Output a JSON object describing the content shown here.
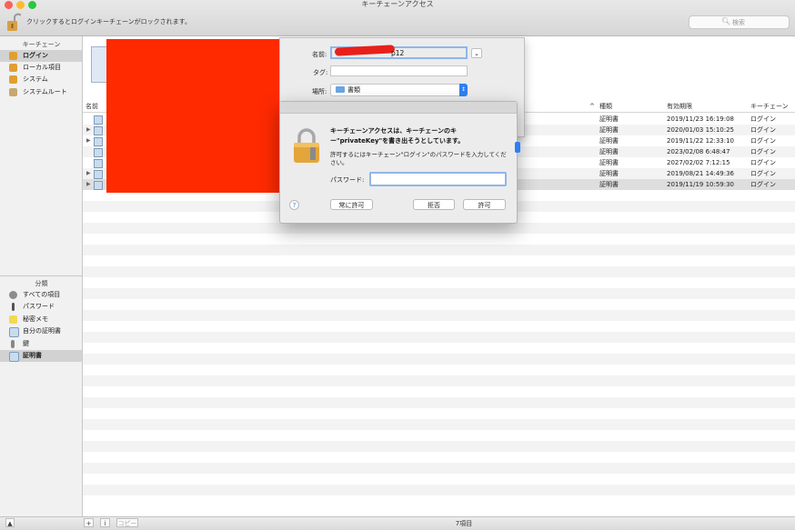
{
  "window": {
    "title": "キーチェーンアクセス"
  },
  "toolbar": {
    "lock_message": "クリックするとログインキーチェーンがロックされます。",
    "search_placeholder": "検索"
  },
  "sidebar": {
    "keychains_header": "キーチェーン",
    "keychains": [
      {
        "label": "ログイン",
        "icon": "lock-open-icon",
        "color": "#e0a030",
        "selected": true
      },
      {
        "label": "ローカル項目",
        "icon": "lock-icon",
        "color": "#e0a030",
        "selected": false
      },
      {
        "label": "システム",
        "icon": "lock-icon",
        "color": "#e0a030",
        "selected": false
      },
      {
        "label": "システムルート",
        "icon": "cabinet-icon",
        "color": "#c8a870",
        "selected": false
      }
    ],
    "category_header": "分類",
    "categories": [
      {
        "label": "すべての項目",
        "icon": "people-icon",
        "selected": false
      },
      {
        "label": "パスワード",
        "icon": "pen-icon",
        "selected": false
      },
      {
        "label": "秘密メモ",
        "icon": "note-icon",
        "selected": false
      },
      {
        "label": "自分の証明書",
        "icon": "my-cert-icon",
        "selected": false
      },
      {
        "label": "鍵",
        "icon": "key-icon",
        "selected": false
      },
      {
        "label": "証明書",
        "icon": "certificate-icon",
        "selected": true
      }
    ]
  },
  "table": {
    "columns": {
      "name": "名前",
      "kind": "種類",
      "expires": "有効期限",
      "keychain": "キーチェーン"
    },
    "rows": [
      {
        "kind": "証明書",
        "expires": "2019/11/23 16:19:08",
        "keychain": "ログイン",
        "expandable": false
      },
      {
        "kind": "証明書",
        "expires": "2020/01/03 15:10:25",
        "keychain": "ログイン",
        "expandable": true
      },
      {
        "kind": "証明書",
        "expires": "2019/11/22 12:33:10",
        "keychain": "ログイン",
        "expandable": true
      },
      {
        "kind": "証明書",
        "expires": "2023/02/08 6:48:47",
        "keychain": "ログイン",
        "expandable": false
      },
      {
        "kind": "証明書",
        "expires": "2027/02/02 7:12:15",
        "keychain": "ログイン",
        "expandable": false
      },
      {
        "kind": "証明書",
        "expires": "2019/08/21 14:49:36",
        "keychain": "ログイン",
        "expandable": true
      },
      {
        "kind": "証明書",
        "expires": "2019/11/19 10:59:30",
        "keychain": "ログイン",
        "expandable": true
      }
    ]
  },
  "save_sheet": {
    "name_label": "名前:",
    "name_value": "p12",
    "tag_label": "タグ:",
    "tag_value": "",
    "location_label": "場所:",
    "location_value": "書類"
  },
  "dialog": {
    "title": "キーチェーンアクセスは、キーチェーンのキー\"privateKey\"を書き出そうとしています。",
    "description": "許可するにはキーチェーン\"ログイン\"のパスワードを入力してください。",
    "password_label": "パスワード:",
    "help_label": "?",
    "always_allow": "常に許可",
    "deny": "拒否",
    "allow": "許可"
  },
  "bottom": {
    "add": "+",
    "info": "i",
    "copy": "コピー",
    "count": "7項目"
  },
  "colors": {
    "accent": "#2f7ff2",
    "redaction": "#ff2a00",
    "selection": "#d2d2d2"
  }
}
